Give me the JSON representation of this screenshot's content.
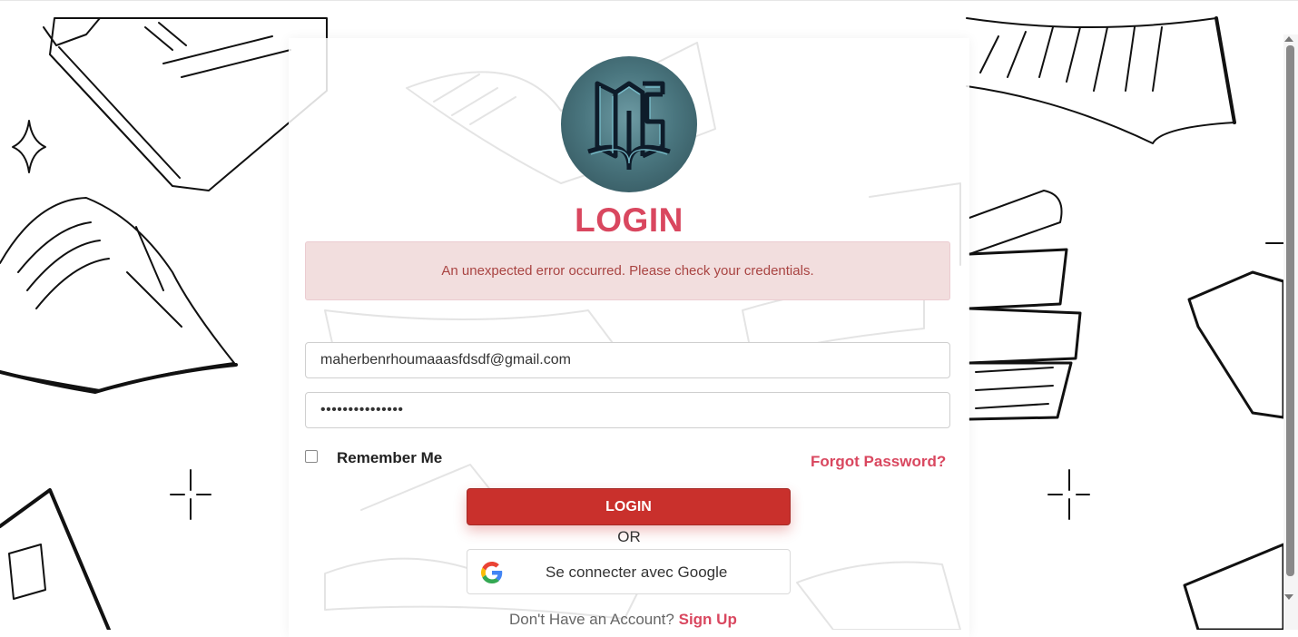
{
  "page": {
    "title": "LOGIN",
    "error_message": "An unexpected error occurred. Please check your credentials."
  },
  "form": {
    "email_value": "maherbenrhoumaaasfdsdf@gmail.com",
    "password_masked": "•••••••••••••••",
    "remember_label": "Remember Me",
    "remember_checked": false,
    "forgot_label": "Forgot Password?",
    "login_button": "LOGIN",
    "or_label": "OR",
    "google_button": "Se connecter avec Google",
    "no_account_text": "Don't Have an Account?",
    "signup_label": "Sign Up"
  },
  "logo": {
    "icon": "lms-book-logo-icon"
  },
  "colors": {
    "accent": "#d9475f",
    "button": "#c9302c",
    "error_bg": "#f2dede",
    "error_text": "#a94442"
  }
}
